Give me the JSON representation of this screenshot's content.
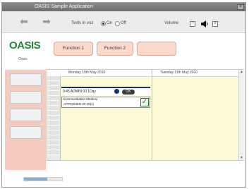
{
  "window": {
    "title": "OASIS Sample Application",
    "close_glyph": "×"
  },
  "toolbar": {
    "back_icon": "back-arrow-icon",
    "forward_icon": "forward-arrow-icon",
    "tts_label": "Texts in voz",
    "tts_on_label": "On",
    "tts_off_label": "Off",
    "tts_value": "On",
    "volume_label": "Volume",
    "volume_down": "−",
    "volume_up": "+",
    "speaker_icon": "speaker-icon"
  },
  "logo": {
    "text": "OASIS",
    "subtitle": "Oasis"
  },
  "functions": [
    {
      "label": "Function 1"
    },
    {
      "label": "Function 2"
    },
    {
      "label": ""
    }
  ],
  "sidebar": {
    "tabs": [
      "",
      "",
      "",
      ""
    ]
  },
  "calendar": {
    "days": [
      "Monday 10th May 2010",
      "Tuesday 11th May 2010"
    ],
    "time_slots": [
      "",
      "",
      "",
      "",
      "",
      "",
      "",
      "",
      "",
      "",
      "",
      "",
      "",
      "",
      "",
      ""
    ],
    "appointments": [
      {
        "text": "0:45 ADMIN 00 1Day",
        "badge": "OK",
        "icon": "moon-icon"
      },
      {
        "line1": "Kommunikation Medical",
        "line2": "APP02/MED 20 20(s)",
        "status": "✓",
        "status_icon": "checkmark-icon"
      }
    ]
  },
  "colors": {
    "accent": "#f6cbbf",
    "button_fill": "#fbd9cd",
    "calendar_bg": "#fdfad6",
    "logo_green": "#1f8a3a",
    "appointment_blue": "#1a2f73",
    "scroll_thumb": "#87aecb"
  },
  "status": {
    "progress": 0.62
  }
}
